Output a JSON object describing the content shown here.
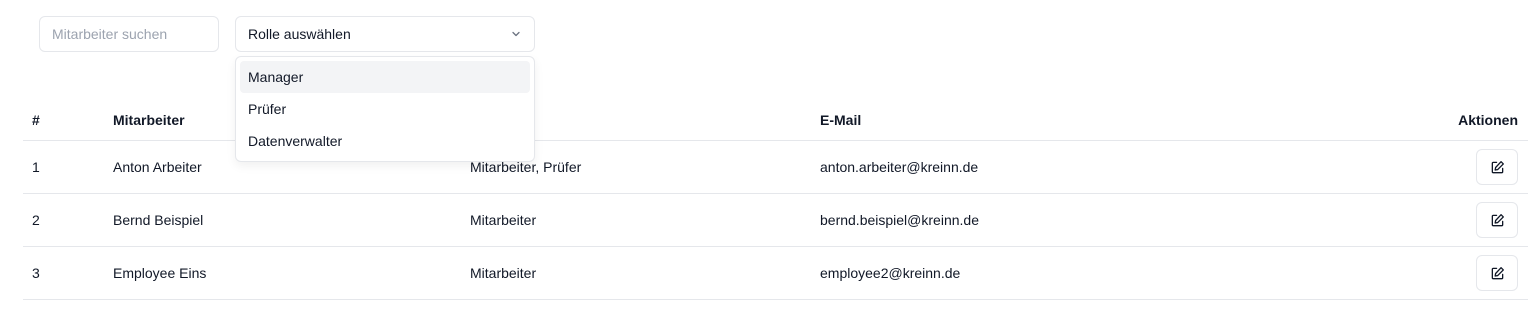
{
  "filters": {
    "search_placeholder": "Mitarbeiter suchen",
    "role_select_label": "Rolle auswählen"
  },
  "dropdown": {
    "options": [
      "Manager",
      "Prüfer",
      "Datenverwalter"
    ],
    "highlighted": "Manager"
  },
  "table": {
    "headers": {
      "num": "#",
      "employee": "Mitarbeiter",
      "email": "E-Mail",
      "actions": "Aktionen"
    },
    "rows": [
      {
        "num": "1",
        "name": "Anton Arbeiter",
        "roles": "Mitarbeiter, Prüfer",
        "email": "anton.arbeiter@kreinn.de"
      },
      {
        "num": "2",
        "name": "Bernd Beispiel",
        "roles": "Mitarbeiter",
        "email": "bernd.beispiel@kreinn.de"
      },
      {
        "num": "3",
        "name": "Employee Eins",
        "roles": "Mitarbeiter",
        "email": "employee2@kreinn.de"
      }
    ]
  },
  "icons": {
    "select_caret": "chevron-down-icon",
    "edit": "edit-icon"
  }
}
